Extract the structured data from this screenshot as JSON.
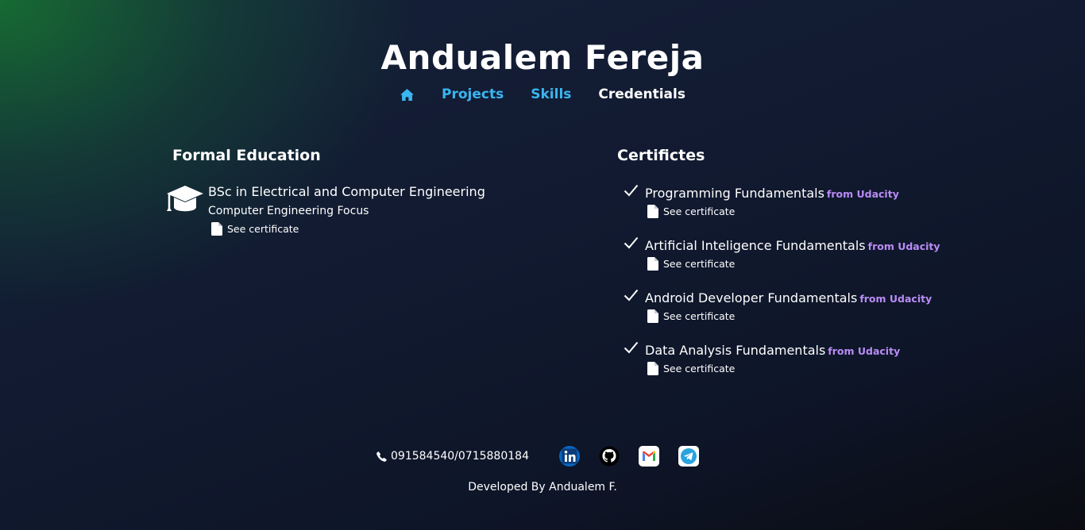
{
  "header": {
    "title": "Andualem Fereja",
    "nav": [
      {
        "label": "Projects"
      },
      {
        "label": "Skills"
      },
      {
        "label": "Credentials"
      }
    ]
  },
  "education": {
    "heading": "Formal Education",
    "degree": "BSc in Electrical and Computer Engineering",
    "focus": "Computer Engineering Focus",
    "certificate_link": "See certificate"
  },
  "certificates": {
    "heading": "Certifictes",
    "items": [
      {
        "name": "Programming Fundamentals",
        "source": "from Udacity",
        "link": "See certificate"
      },
      {
        "name": "Artificial Inteligence Fundamentals",
        "source": "from Udacity",
        "link": "See certificate"
      },
      {
        "name": "Android Developer Fundamentals",
        "source": "from Udacity",
        "link": "See certificate"
      },
      {
        "name": "Data Analysis Fundamentals",
        "source": "from Udacity",
        "link": "See certificate"
      }
    ]
  },
  "footer": {
    "phone": "091584540/0715880184",
    "social": [
      "linkedin-icon",
      "github-icon",
      "gmail-icon",
      "telegram-icon"
    ],
    "credit": "Developed By Andualem F."
  },
  "colors": {
    "accent_link": "#3ab6f0",
    "source_label": "#b98cf5",
    "gradient_green": "#166e32",
    "background_dark": "#111a30"
  }
}
